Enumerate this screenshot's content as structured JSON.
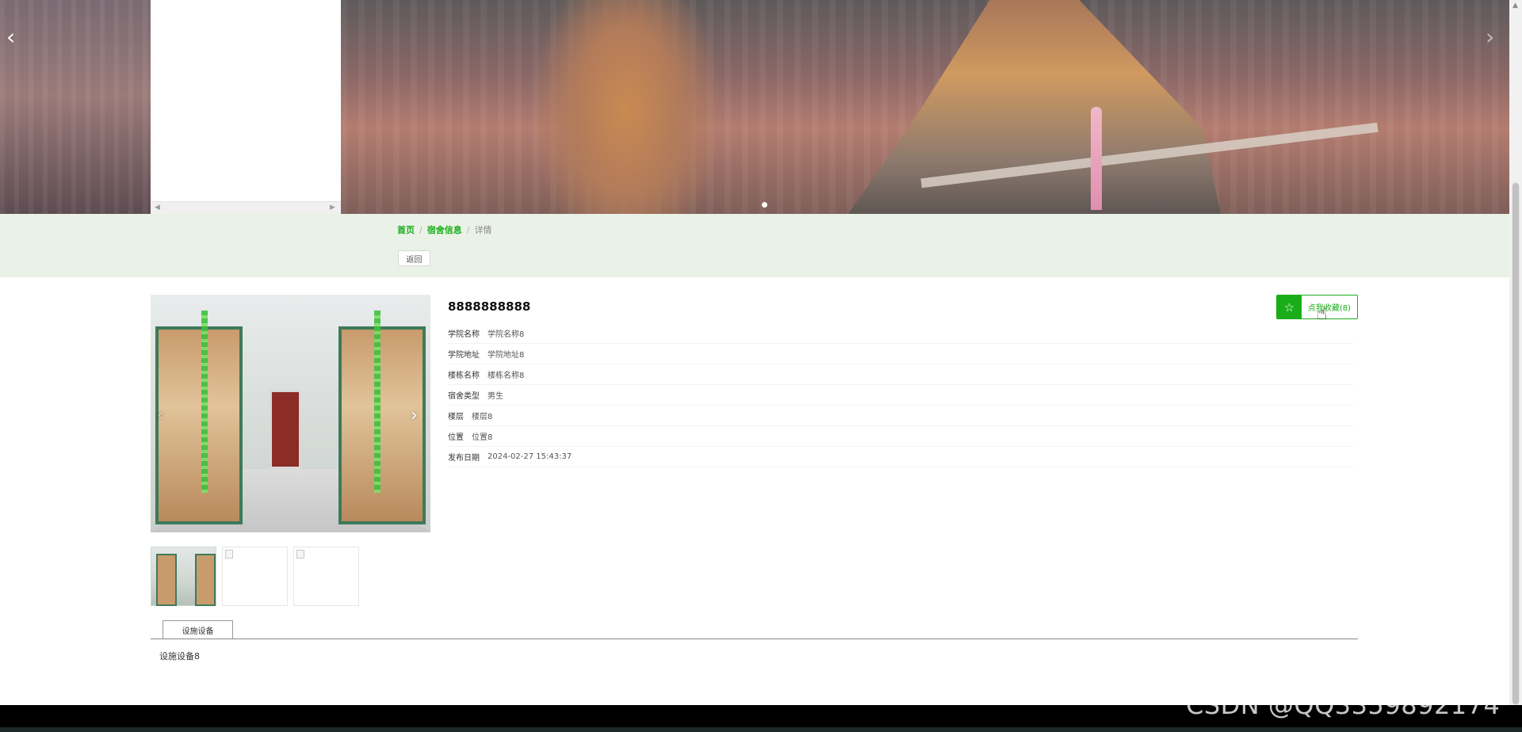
{
  "banner": {
    "prev_icon": "chevron-left-icon",
    "next_icon": "chevron-right-icon",
    "prev_glyph": "‹",
    "next_glyph": "›",
    "dots": 1
  },
  "breadcrumb": {
    "home": "首页",
    "category": "宿舍信息",
    "current": "详情",
    "separator": "/"
  },
  "back_label": "返回",
  "detail": {
    "title": "8888888888",
    "fields": [
      {
        "label": "学院名称",
        "value": "学院名称8"
      },
      {
        "label": "学院地址",
        "value": "学院地址8"
      },
      {
        "label": "楼栋名称",
        "value": "楼栋名称8"
      },
      {
        "label": "宿舍类型",
        "value": "男生"
      },
      {
        "label": "楼层",
        "value": "楼层8"
      },
      {
        "label": "位置",
        "value": "位置8"
      },
      {
        "label": "发布日期",
        "value": "2024-02-27 15:43:37"
      }
    ],
    "favorite": {
      "label": "点我收藏(8)",
      "icon": "star-outline-icon",
      "glyph": "☆"
    }
  },
  "gallery": {
    "prev_glyph": "‹",
    "next_glyph": "›",
    "thumbnail_count": 3
  },
  "tabs": [
    {
      "label": "设施设备",
      "content": "设施设备8"
    }
  ],
  "watermark": "CSDN @QQ3359892174",
  "colors": {
    "accent": "#1aad19",
    "breadcrumb_bg": "#eaf2e7"
  }
}
